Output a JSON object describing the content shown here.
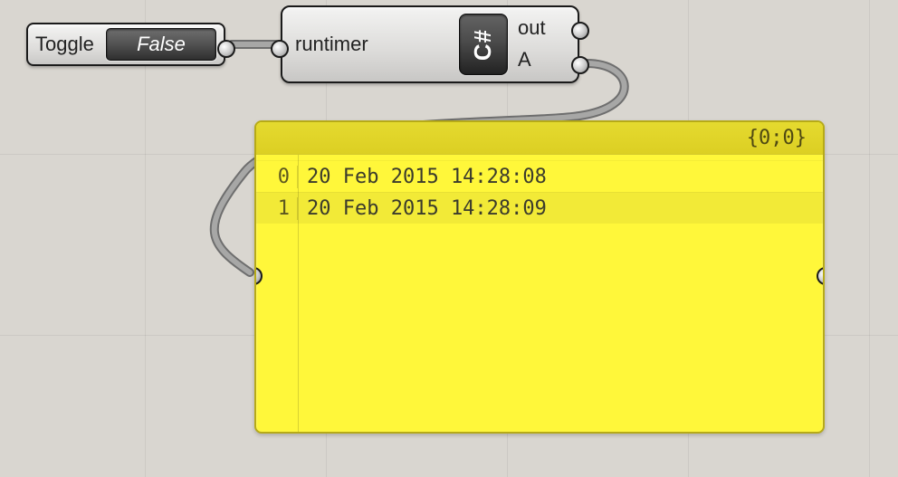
{
  "toggle": {
    "label": "Toggle",
    "value": "False"
  },
  "script": {
    "input_label": "runtimer",
    "icon_text": "C#",
    "outputs": [
      "out",
      "A"
    ]
  },
  "panel": {
    "header_path": "{0;0}",
    "rows": [
      {
        "index": "0",
        "value": "20 Feb 2015 14:28:08"
      },
      {
        "index": "1",
        "value": "20 Feb 2015 14:28:09"
      }
    ]
  }
}
